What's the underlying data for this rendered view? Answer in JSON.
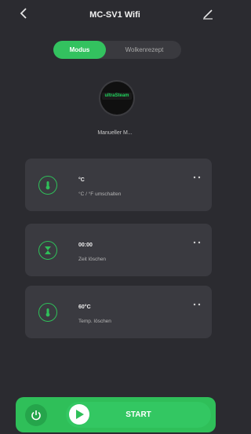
{
  "header": {
    "title": "MC-SV1 Wifi",
    "back_icon": "chevron-left-icon",
    "edit_icon": "edit-icon"
  },
  "tabs": [
    {
      "label": "Modus",
      "active": true
    },
    {
      "label": "Wolkenrezept",
      "active": false
    }
  ],
  "device": {
    "name": "Manueller M...",
    "brand_text": "ultraSteam"
  },
  "settings": [
    {
      "title": "°C",
      "subtitle": "°C / °F umschalten",
      "icon": "thermometer-icon"
    },
    {
      "title": "00:00",
      "subtitle": "Zeit löschen",
      "icon": "hourglass-icon"
    },
    {
      "title": "60°C",
      "subtitle": "Temp. löschen",
      "icon": "thermometer-icon"
    }
  ],
  "footer": {
    "start_label": "START",
    "power_icon": "power-icon",
    "play_icon": "play-icon"
  },
  "colors": {
    "background": "#2b2b30",
    "card": "#3a3a40",
    "accent": "#2fbf59"
  }
}
